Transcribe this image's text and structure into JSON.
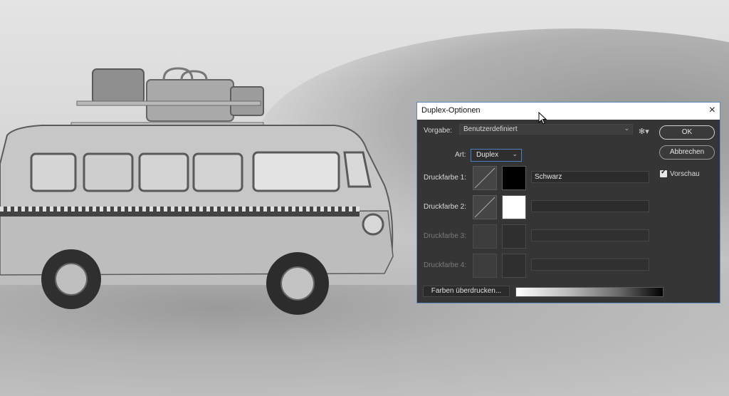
{
  "dialog": {
    "title": "Duplex-Optionen",
    "close_glyph": "×",
    "preset": {
      "label": "Vorgabe:",
      "value": "Benutzerdefiniert"
    },
    "type": {
      "label": "Art:",
      "value": "Duplex"
    },
    "inks": [
      {
        "label": "Druckfarbe 1:",
        "name": "Schwarz",
        "color": "#000000",
        "enabled": true
      },
      {
        "label": "Druckfarbe 2:",
        "name": "",
        "color": "#ffffff",
        "enabled": true
      },
      {
        "label": "Druckfarbe 3:",
        "name": "",
        "color": "",
        "enabled": false
      },
      {
        "label": "Druckfarbe 4:",
        "name": "",
        "color": "",
        "enabled": false
      }
    ],
    "buttons": {
      "ok": "OK",
      "cancel": "Abbrechen",
      "overprint": "Farben überdrucken..."
    },
    "preview": {
      "label": "Vorschau",
      "checked": true
    },
    "icons": {
      "gear": "gear-icon",
      "chevron": "chevron-down-icon",
      "close": "close-icon"
    }
  }
}
